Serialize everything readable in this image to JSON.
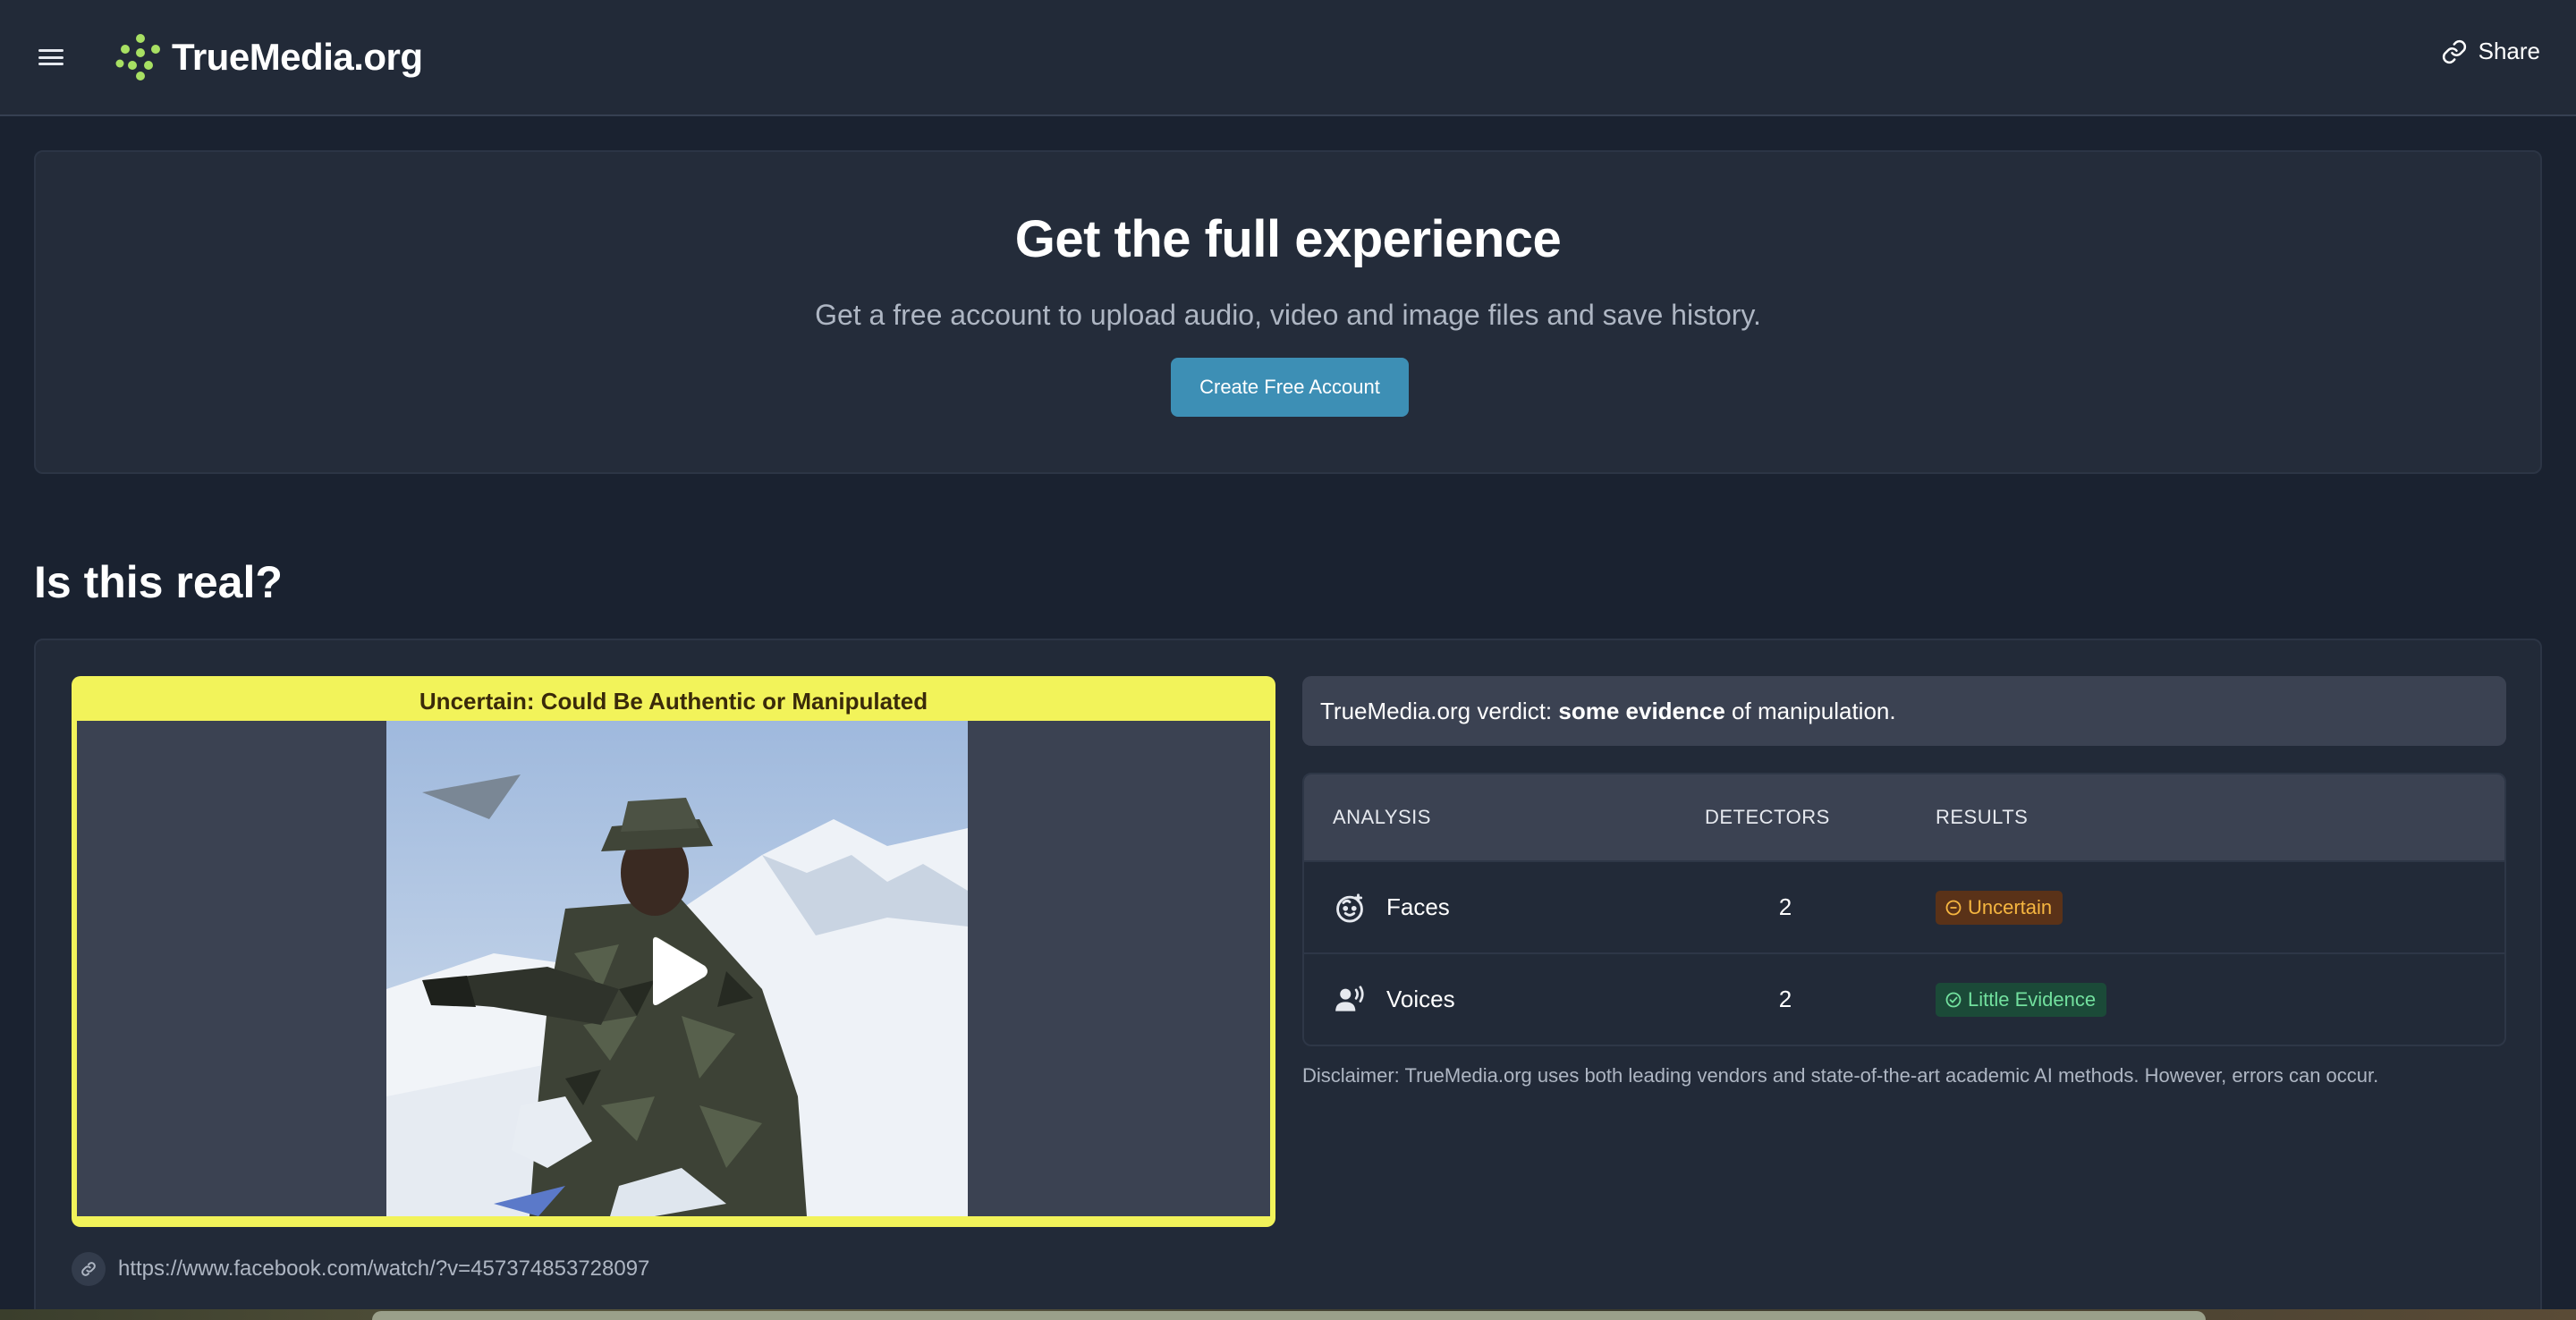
{
  "header": {
    "logo_text": "TrueMedia.org",
    "share_label": "Share",
    "brand_color": "#a8e063"
  },
  "promo": {
    "title": "Get the full experience",
    "subtitle": "Get a free account to upload audio, video and image files and save history.",
    "button_label": "Create Free Account"
  },
  "result": {
    "section_title": "Is this real?",
    "media_banner": "Uncertain: Could Be Authentic or Manipulated",
    "source_url": "https://www.facebook.com/watch/?v=457374853728097",
    "verdict_prefix": "TrueMedia.org verdict: ",
    "verdict_emphasis": "some evidence",
    "verdict_suffix": " of manipulation.",
    "table": {
      "headers": {
        "analysis": "ANALYSIS",
        "detectors": "DETECTORS",
        "results": "RESULTS"
      },
      "rows": [
        {
          "label": "Faces",
          "detectors": "2",
          "result": "Uncertain",
          "icon": "face-icon",
          "status": "uncertain"
        },
        {
          "label": "Voices",
          "detectors": "2",
          "result": "Little Evidence",
          "icon": "voice-icon",
          "status": "little-evidence"
        }
      ]
    },
    "disclaimer": "Disclaimer: TrueMedia.org uses both leading vendors and state-of-the-art academic AI methods. However, errors can occur."
  },
  "colors": {
    "banner_yellow": "#f2f35a",
    "button_blue": "#3d8fb5",
    "uncertain": "#f6b640",
    "little_evidence": "#72e09e"
  }
}
